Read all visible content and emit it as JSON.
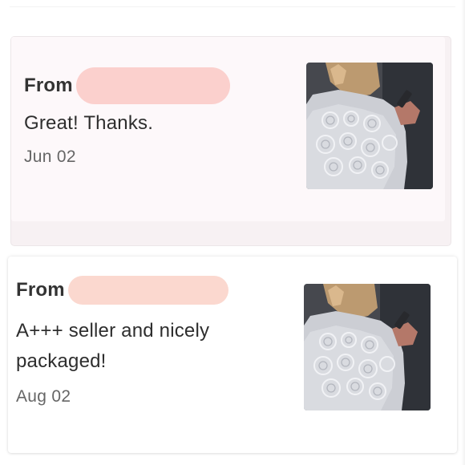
{
  "reviews": [
    {
      "from_label": "From",
      "message": "Great! Thanks.",
      "date": "Jun 02",
      "thumbnail_icon": "product-photo-lace-blouse"
    },
    {
      "from_label": "From",
      "message": "A+++ seller and nicely packaged!",
      "date": "Aug 02",
      "thumbnail_icon": "product-photo-lace-blouse"
    }
  ],
  "colors": {
    "redaction": "#fbd4cf",
    "card_tint": "#fdf8fa"
  }
}
